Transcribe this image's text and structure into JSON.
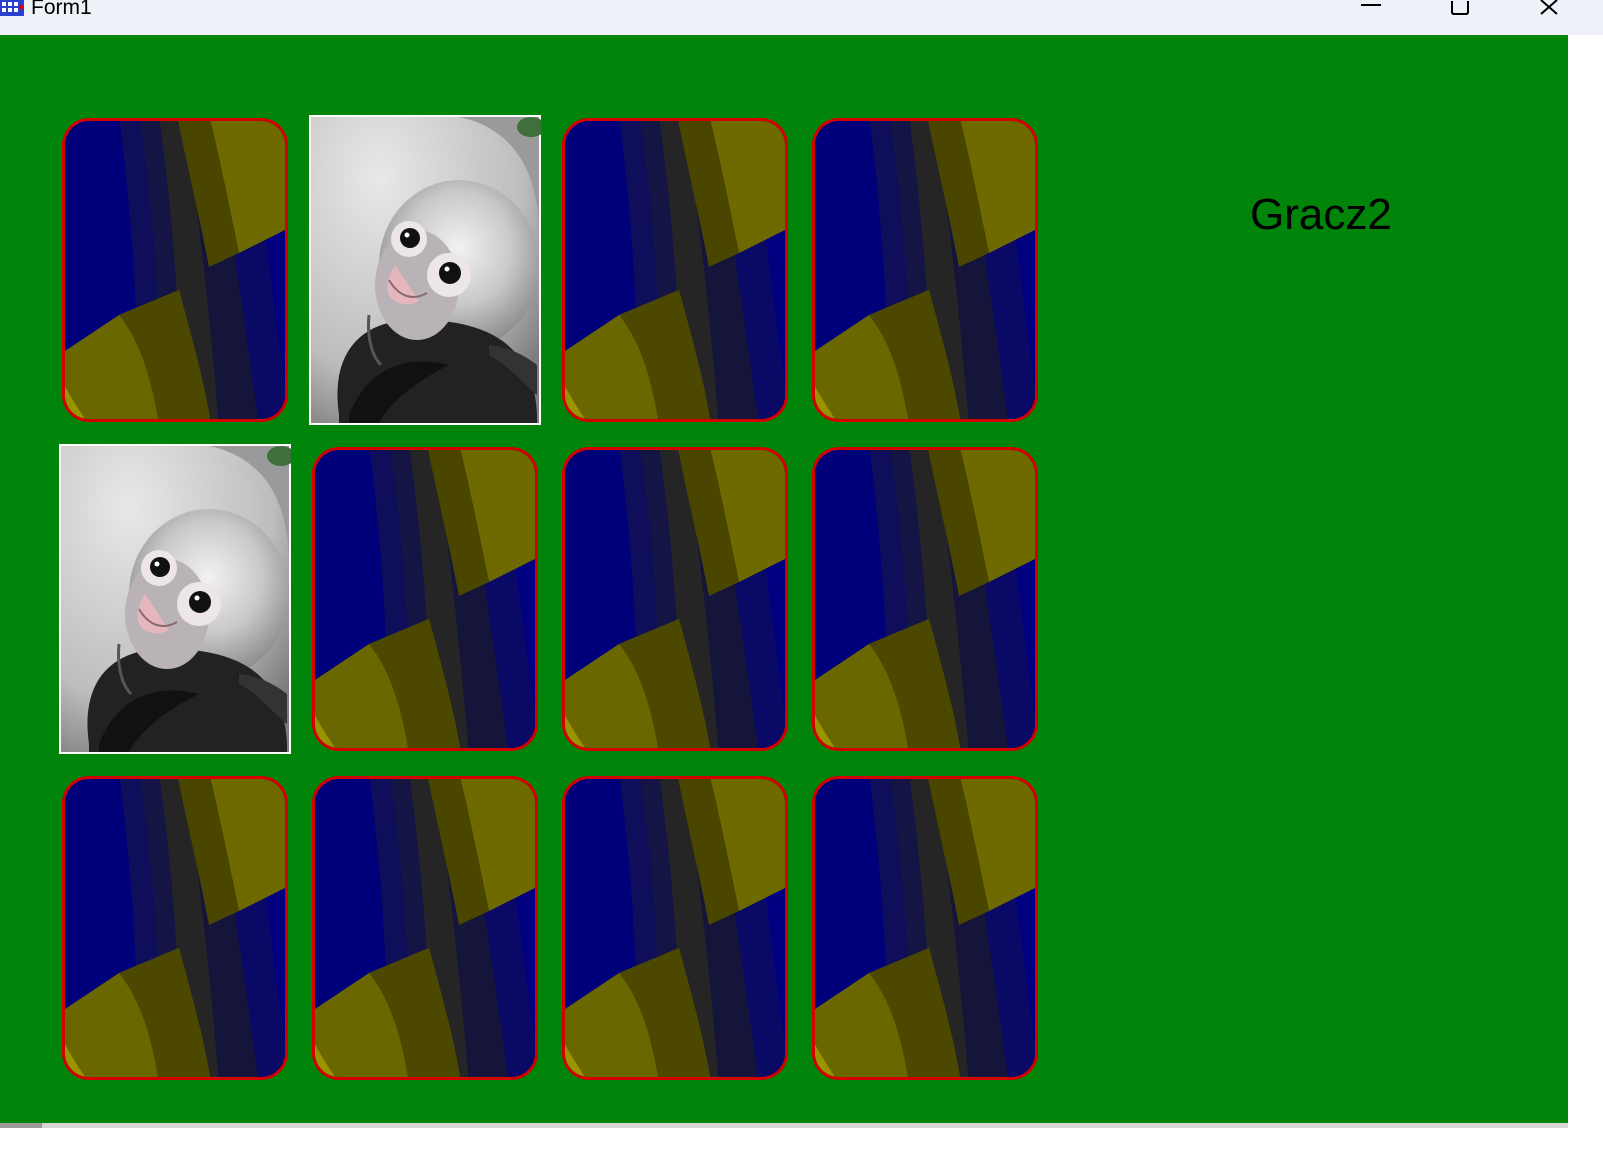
{
  "window": {
    "title": "Form1",
    "icons": {
      "app": "app-icon",
      "minimize": "minimize-icon",
      "maximize": "maximize-icon",
      "close": "close-icon"
    }
  },
  "colors": {
    "background": "#00850a",
    "card_border": "#d40000",
    "card_blue": "#000080",
    "card_olive": "#7a7a00"
  },
  "game": {
    "current_player": "Gracz2",
    "grid": {
      "rows": 3,
      "columns": 4
    },
    "cards": [
      {
        "row": 1,
        "col": 1,
        "face": "back"
      },
      {
        "row": 1,
        "col": 2,
        "face": "monkey"
      },
      {
        "row": 1,
        "col": 3,
        "face": "back"
      },
      {
        "row": 1,
        "col": 4,
        "face": "back"
      },
      {
        "row": 2,
        "col": 1,
        "face": "monkey"
      },
      {
        "row": 2,
        "col": 2,
        "face": "back"
      },
      {
        "row": 2,
        "col": 3,
        "face": "back"
      },
      {
        "row": 2,
        "col": 4,
        "face": "back"
      },
      {
        "row": 3,
        "col": 1,
        "face": "back"
      },
      {
        "row": 3,
        "col": 2,
        "face": "back"
      },
      {
        "row": 3,
        "col": 3,
        "face": "back"
      },
      {
        "row": 3,
        "col": 4,
        "face": "back"
      }
    ]
  }
}
